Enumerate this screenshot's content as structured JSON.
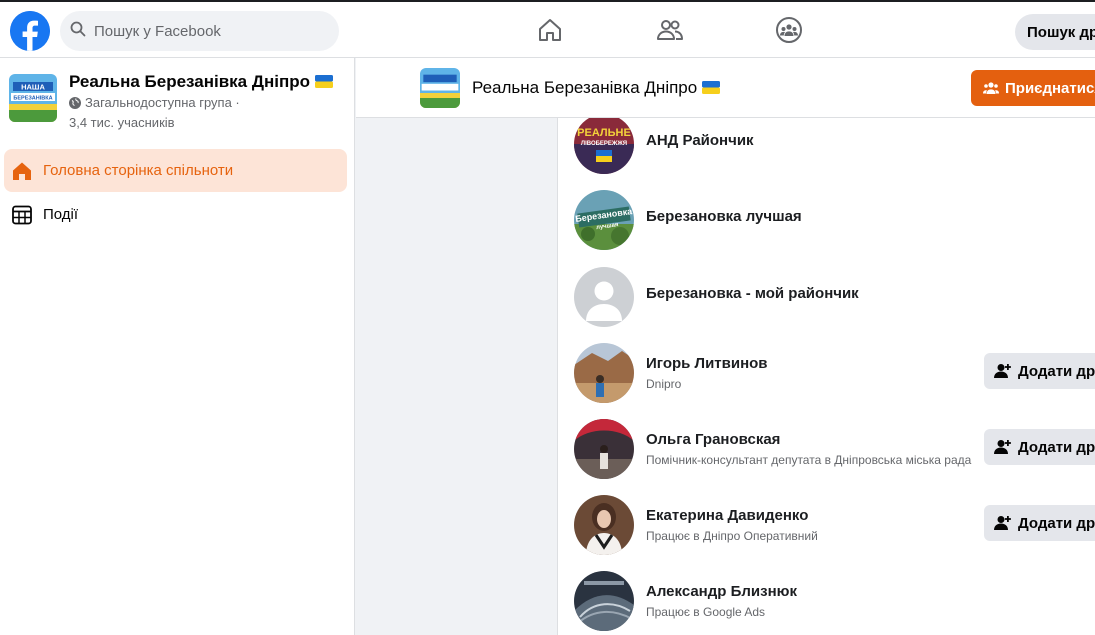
{
  "topbar": {
    "search_placeholder": "Пошук у Facebook",
    "search_button_label": "Пошук др"
  },
  "group": {
    "name": "Реальна Березанівка Дніпро",
    "privacy": "Загальнодоступна група ·",
    "members": "3,4 тис. учасників",
    "thumb_text_top": "НАША",
    "thumb_text_bottom": "БЕРЕЗАНІВКА",
    "join_label": "Приєднатися"
  },
  "sidebar": {
    "items": [
      {
        "label": "Головна сторінка спільноти",
        "icon": "home-icon",
        "active": true
      },
      {
        "label": "Події",
        "icon": "calendar-icon",
        "active": false
      }
    ]
  },
  "members": [
    {
      "name": "АНД Райончик",
      "subtitle": ""
    },
    {
      "name": "Березановка лучшая",
      "subtitle": ""
    },
    {
      "name": "Березановка - мой райончик",
      "subtitle": ""
    },
    {
      "name": "Игорь Литвинов",
      "subtitle": "Dnipro",
      "button": "Додати дру"
    },
    {
      "name": "Ольга Грановская",
      "subtitle": "Помічник-консультант депутата в Дніпровська міська рада",
      "button": "Додати дру"
    },
    {
      "name": "Екатерина Давиденко",
      "subtitle": "Працює в Дніпро Оперативний",
      "button": "Додати дру"
    },
    {
      "name": "Александр Близнюк",
      "subtitle": "Працює в Google Ads"
    }
  ],
  "avatar_texts": {
    "m0_top": "РЕАЛЬНЕ",
    "m0_bottom": "ЛІВОБЕРЕЖЖЯ",
    "m1_top": "Березановка",
    "m1_bottom": "лучшая"
  },
  "colors": {
    "brand_blue": "#1877f2",
    "accent_orange": "#e4600f",
    "active_bg": "#fde4d7"
  }
}
